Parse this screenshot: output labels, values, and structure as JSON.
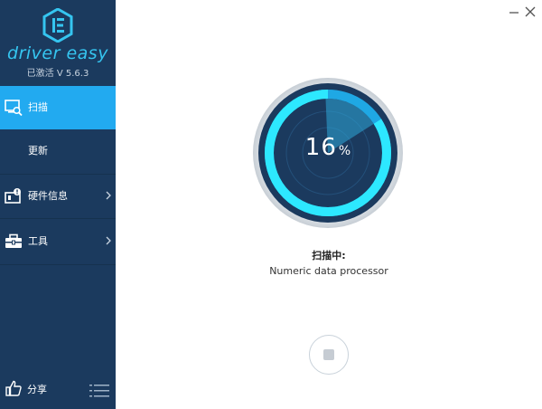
{
  "brand": {
    "name": "driver easy",
    "version": "已激活 V 5.6.3"
  },
  "colors": {
    "sidebar_bg": "#1b3a5e",
    "active_nav": "#22aaf0",
    "brand": "#35c5f0",
    "gauge_ring": "#1fc6f4",
    "gauge_bg": "#1b3a5e"
  },
  "nav": {
    "items": [
      {
        "label": "扫描",
        "icon": "scan-icon",
        "active": true
      },
      {
        "label": "更新",
        "icon": "",
        "active": false
      },
      {
        "label": "硬件信息",
        "icon": "hardware-info-icon",
        "active": false,
        "has_submenu": true
      },
      {
        "label": "工具",
        "icon": "toolbox-icon",
        "active": false,
        "has_submenu": true
      }
    ]
  },
  "footer": {
    "share_label": "分享",
    "share_icon": "thumbs-up-icon",
    "menu_icon": "menu-icon"
  },
  "window": {
    "minimize_icon": "minimize-icon",
    "close_icon": "close-icon"
  },
  "scan": {
    "progress": 16,
    "percent_sign": "%",
    "status_title": "扫描中:",
    "current_item": "Numeric data processor",
    "stop_icon": "stop-icon"
  }
}
